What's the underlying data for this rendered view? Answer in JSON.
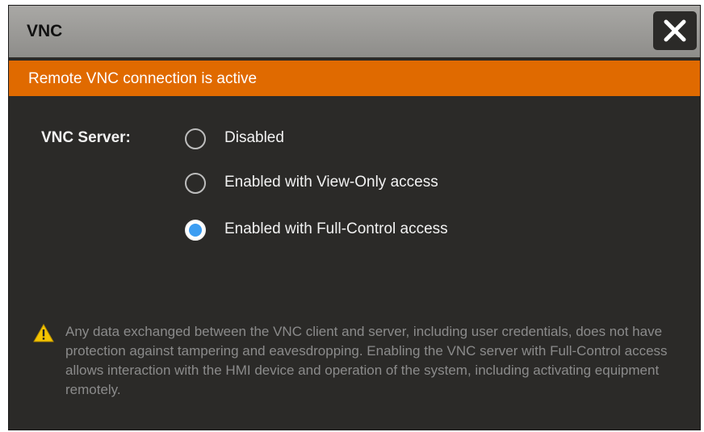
{
  "dialog": {
    "title": "VNC",
    "close_icon": "close-icon"
  },
  "banner": {
    "text": "Remote VNC connection is active",
    "color": "#e06a00"
  },
  "vnc_server": {
    "label": "VNC Server:",
    "options": [
      {
        "label": "Disabled",
        "selected": false
      },
      {
        "label": "Enabled with View-Only access",
        "selected": false
      },
      {
        "label": "Enabled with Full-Control access",
        "selected": true
      }
    ],
    "selected_color": "#3b9df2"
  },
  "warning": {
    "icon": "warning-icon",
    "text": "Any data exchanged between the VNC client and server, including user credentials, does not have protection against tampering and eavesdropping. Enabling the VNC server with Full-Control access allows interaction with the HMI device and operation of the system, including activating equipment remotely."
  }
}
